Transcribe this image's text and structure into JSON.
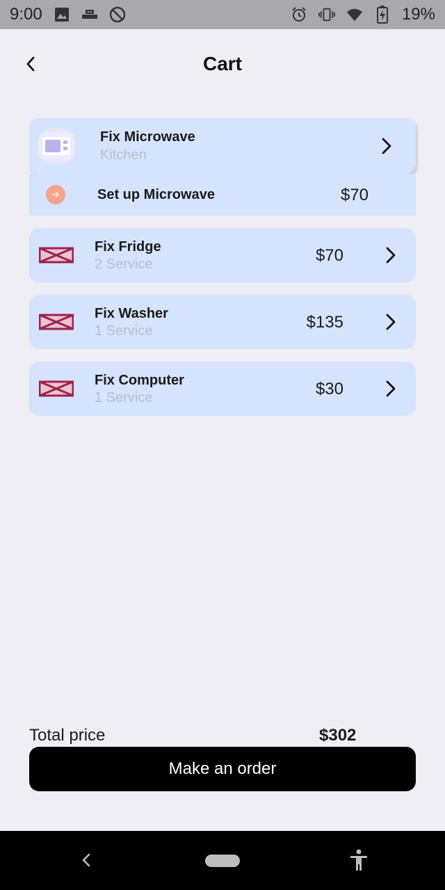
{
  "status_bar": {
    "time": "9:00",
    "battery": "19%",
    "icons_left": [
      "image-icon",
      "usb-icon",
      "do-not-disturb-icon"
    ],
    "icons_right": [
      "alarm-icon",
      "vibrate-icon",
      "wifi-icon",
      "battery-charging-icon"
    ]
  },
  "header": {
    "title": "Cart",
    "back_icon": "chevron-left-icon"
  },
  "cart": {
    "expanded": {
      "title": "Fix Microwave",
      "subtitle": "Kitchen",
      "icon": "microwave-icon",
      "sub_items": [
        {
          "label": "Set up Microwave",
          "price": "$70",
          "icon": "arrow-right-circle-icon"
        }
      ]
    },
    "items": [
      {
        "title": "Fix Fridge",
        "subtitle": "2 Service",
        "price": "$70",
        "icon": "broken-image-icon"
      },
      {
        "title": "Fix Washer",
        "subtitle": "1 Service",
        "price": "$135",
        "icon": "broken-image-icon"
      },
      {
        "title": "Fix Computer",
        "subtitle": "1 Service",
        "price": "$30",
        "icon": "broken-image-icon"
      }
    ]
  },
  "footer": {
    "total_label": "Total price",
    "total_value": "$302",
    "order_button": "Make an order"
  },
  "colors": {
    "background": "#EEEEF4",
    "card": "#D5E3FD",
    "status_bar": "#A9A9AD",
    "button": "#000000",
    "accent_orange": "#F2A48C",
    "broken_icon": "#A0204A"
  }
}
